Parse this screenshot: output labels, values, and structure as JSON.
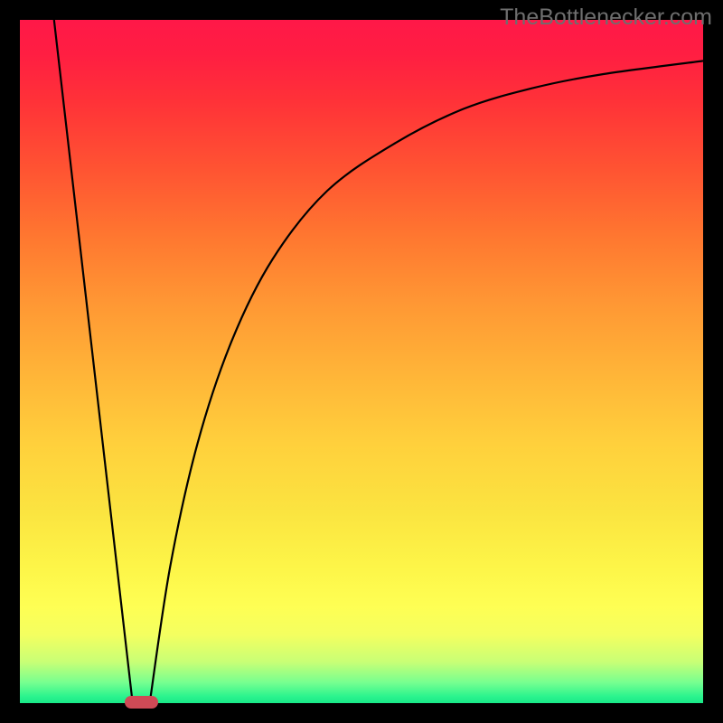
{
  "watermark": "TheBottlenecker.com",
  "chart_data": {
    "type": "line",
    "title": "",
    "xlabel": "",
    "ylabel": "",
    "xlim": [
      0,
      100
    ],
    "ylim": [
      0,
      100
    ],
    "series": [
      {
        "name": "left-line",
        "type": "line",
        "points": [
          {
            "x": 5,
            "y": 100
          },
          {
            "x": 16.5,
            "y": 0
          }
        ]
      },
      {
        "name": "right-curve",
        "type": "curve",
        "points": [
          {
            "x": 19,
            "y": 0
          },
          {
            "x": 22,
            "y": 20
          },
          {
            "x": 26,
            "y": 38
          },
          {
            "x": 31,
            "y": 53
          },
          {
            "x": 37,
            "y": 65
          },
          {
            "x": 45,
            "y": 75
          },
          {
            "x": 55,
            "y": 82
          },
          {
            "x": 65,
            "y": 87
          },
          {
            "x": 75,
            "y": 90
          },
          {
            "x": 85,
            "y": 92
          },
          {
            "x": 100,
            "y": 94
          }
        ]
      }
    ],
    "marker": {
      "x_center": 17.8,
      "y": 0,
      "width_pct": 5,
      "shape": "rounded-rect",
      "color": "#cf4a56"
    },
    "gradient_background": {
      "type": "vertical",
      "colors": [
        "#ff1848",
        "#ff9934",
        "#feff54",
        "#18e888"
      ],
      "description": "red-orange-yellow-green from top to bottom"
    }
  },
  "layout": {
    "outer_size": 800,
    "border_width": 22,
    "plot_size": 756
  }
}
